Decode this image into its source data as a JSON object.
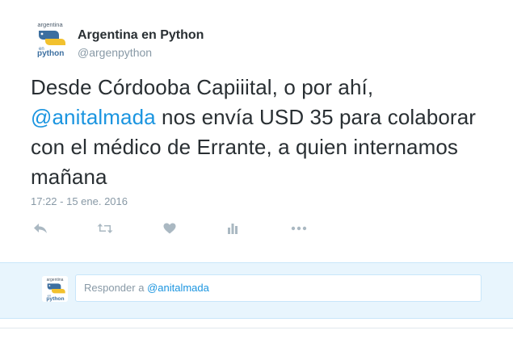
{
  "profile": {
    "name": "Argentina en Python",
    "handle": "@argenpython",
    "logo_text_top": "argentina",
    "logo_text_mid": "en",
    "logo_text_bottom": "python"
  },
  "tweet": {
    "text_part1": "Desde Córdooba Capiiital, o por ahí,",
    "mention": "@anitalmada",
    "text_part2": " nos envía USD 35 para colaborar con el médico de Errante, a quien internamos mañana",
    "timestamp": "17:22 - 15 ene. 2016"
  },
  "actions": [
    {
      "name": "reply",
      "icon": "reply-icon"
    },
    {
      "name": "retweet",
      "icon": "retweet-icon"
    },
    {
      "name": "like",
      "icon": "heart-icon"
    },
    {
      "name": "analytics",
      "icon": "bar-chart-icon"
    },
    {
      "name": "more",
      "icon": "more-dots-icon"
    }
  ],
  "reply": {
    "prefix": "Responder a ",
    "mention": "@anitalmada"
  },
  "colors": {
    "accent": "#1b95e0",
    "muted": "#8899a6",
    "text": "#292f33",
    "reply_bg": "#e8f5fd"
  }
}
